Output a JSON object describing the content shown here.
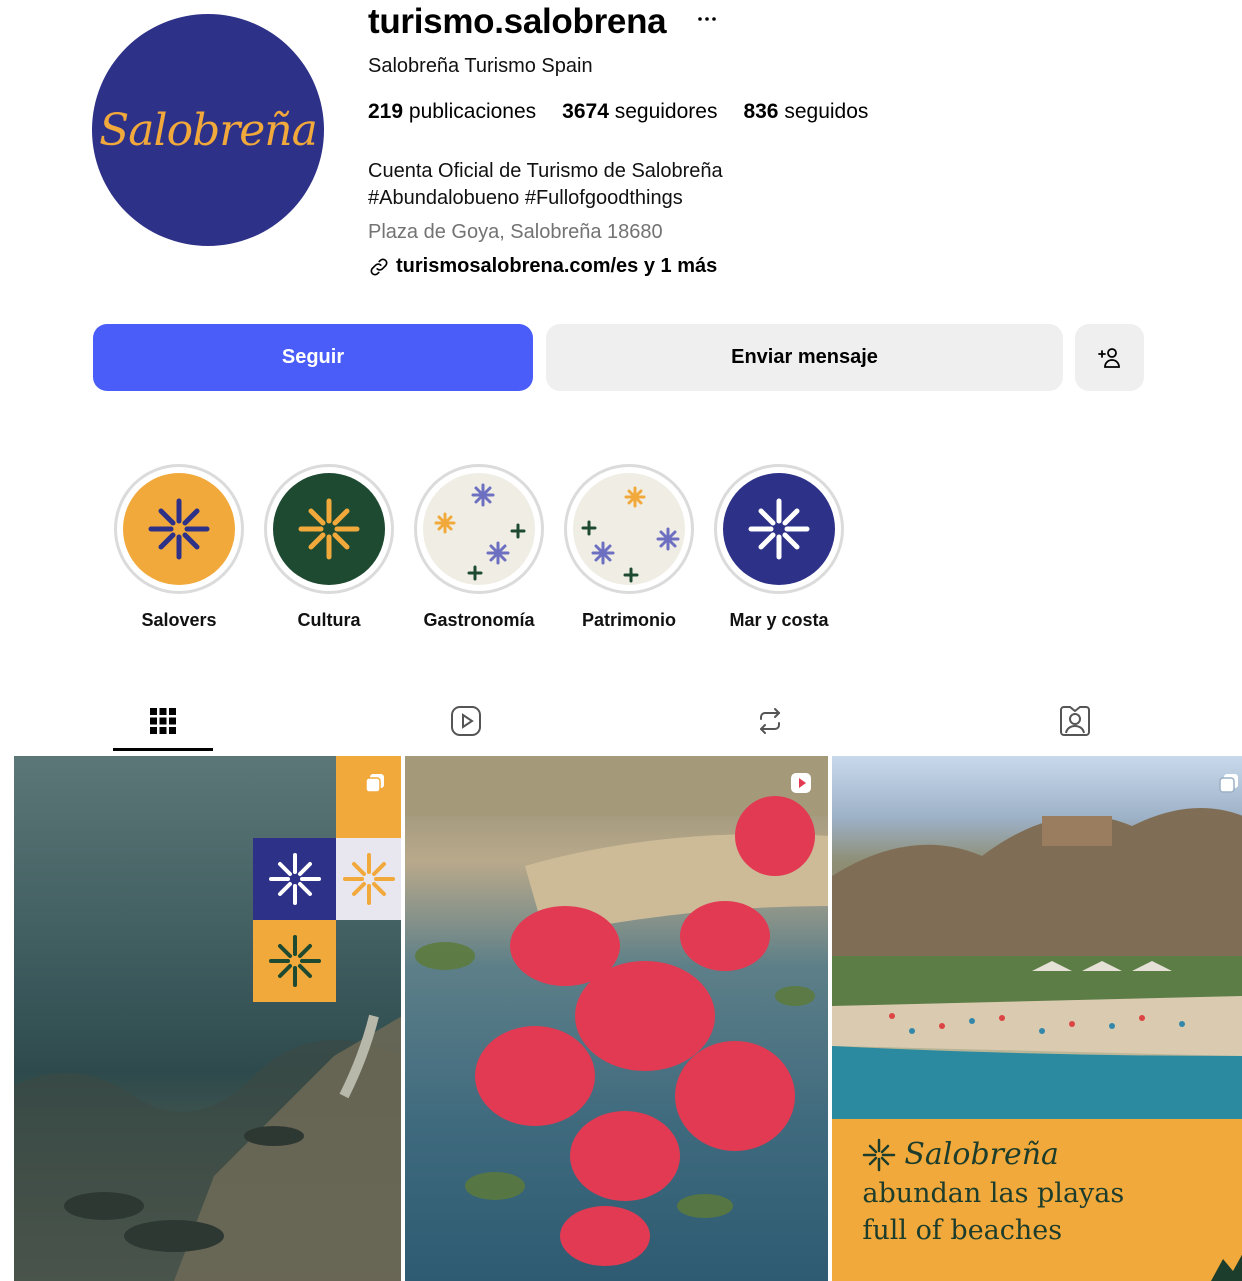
{
  "profile": {
    "username": "turismo.salobrena",
    "avatar_text": "Salobreña",
    "full_name": "Salobreña Turismo Spain",
    "stats": {
      "posts_count": "219",
      "posts_label": "publicaciones",
      "followers_count": "3674",
      "followers_label": "seguidores",
      "following_count": "836",
      "following_label": "seguidos"
    },
    "bio_line1": "Cuenta Oficial de Turismo de Salobreña",
    "bio_line2": "#Abundalobueno #Fullofgoodthings",
    "address": "Plaza de Goya, Salobreña 18680",
    "link": "turismosalobrena.com/es y 1 más"
  },
  "actions": {
    "follow": "Seguir",
    "message": "Enviar mensaje"
  },
  "highlights": [
    {
      "label": "Salovers",
      "bg": "#f2a93b",
      "star": "#2d3188"
    },
    {
      "label": "Cultura",
      "bg": "#1d4a30",
      "star": "#f2a93b"
    },
    {
      "label": "Gastronomía",
      "bg": "#f0ede4",
      "star": "#6d6fc0"
    },
    {
      "label": "Patrimonio",
      "bg": "#f0ede4",
      "star": "#6d6fc0"
    },
    {
      "label": "Mar y costa",
      "bg": "#2d3188",
      "star": "#ffffff"
    }
  ],
  "posts": [
    {
      "type": "carousel"
    },
    {
      "type": "reel"
    },
    {
      "type": "carousel",
      "brand": "Salobreña",
      "line1": "abundan las playas",
      "line2": "full of beaches"
    }
  ],
  "colors": {
    "accent": "#4a5df9",
    "brand_blue": "#2d3188",
    "brand_orange": "#f2a93b",
    "brand_green": "#1d4a30"
  }
}
